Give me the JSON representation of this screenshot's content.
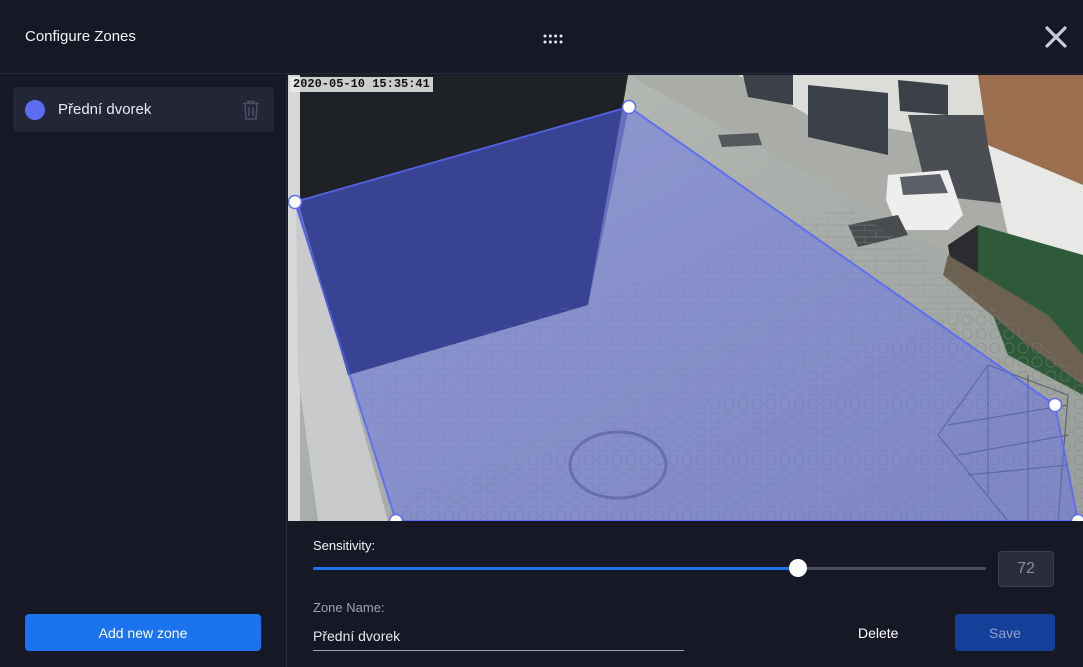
{
  "header": {
    "title": "Configure Zones"
  },
  "sidebar": {
    "zones": [
      {
        "label": "Přední dvorek",
        "color": "#5e6cf2"
      }
    ],
    "add_zone_label": "Add new zone"
  },
  "camera": {
    "timestamp": "2020-05-10 15:35:41",
    "zone_color": "#5e6cf2"
  },
  "controls": {
    "sensitivity_label": "Sensitivity:",
    "sensitivity_value": "72",
    "sensitivity_percent": 72,
    "zone_name_label": "Zone Name:",
    "zone_name_value": "Přední dvorek",
    "delete_label": "Delete",
    "save_label": "Save"
  },
  "colors": {
    "accent": "#1b73f0",
    "background": "#161826"
  }
}
